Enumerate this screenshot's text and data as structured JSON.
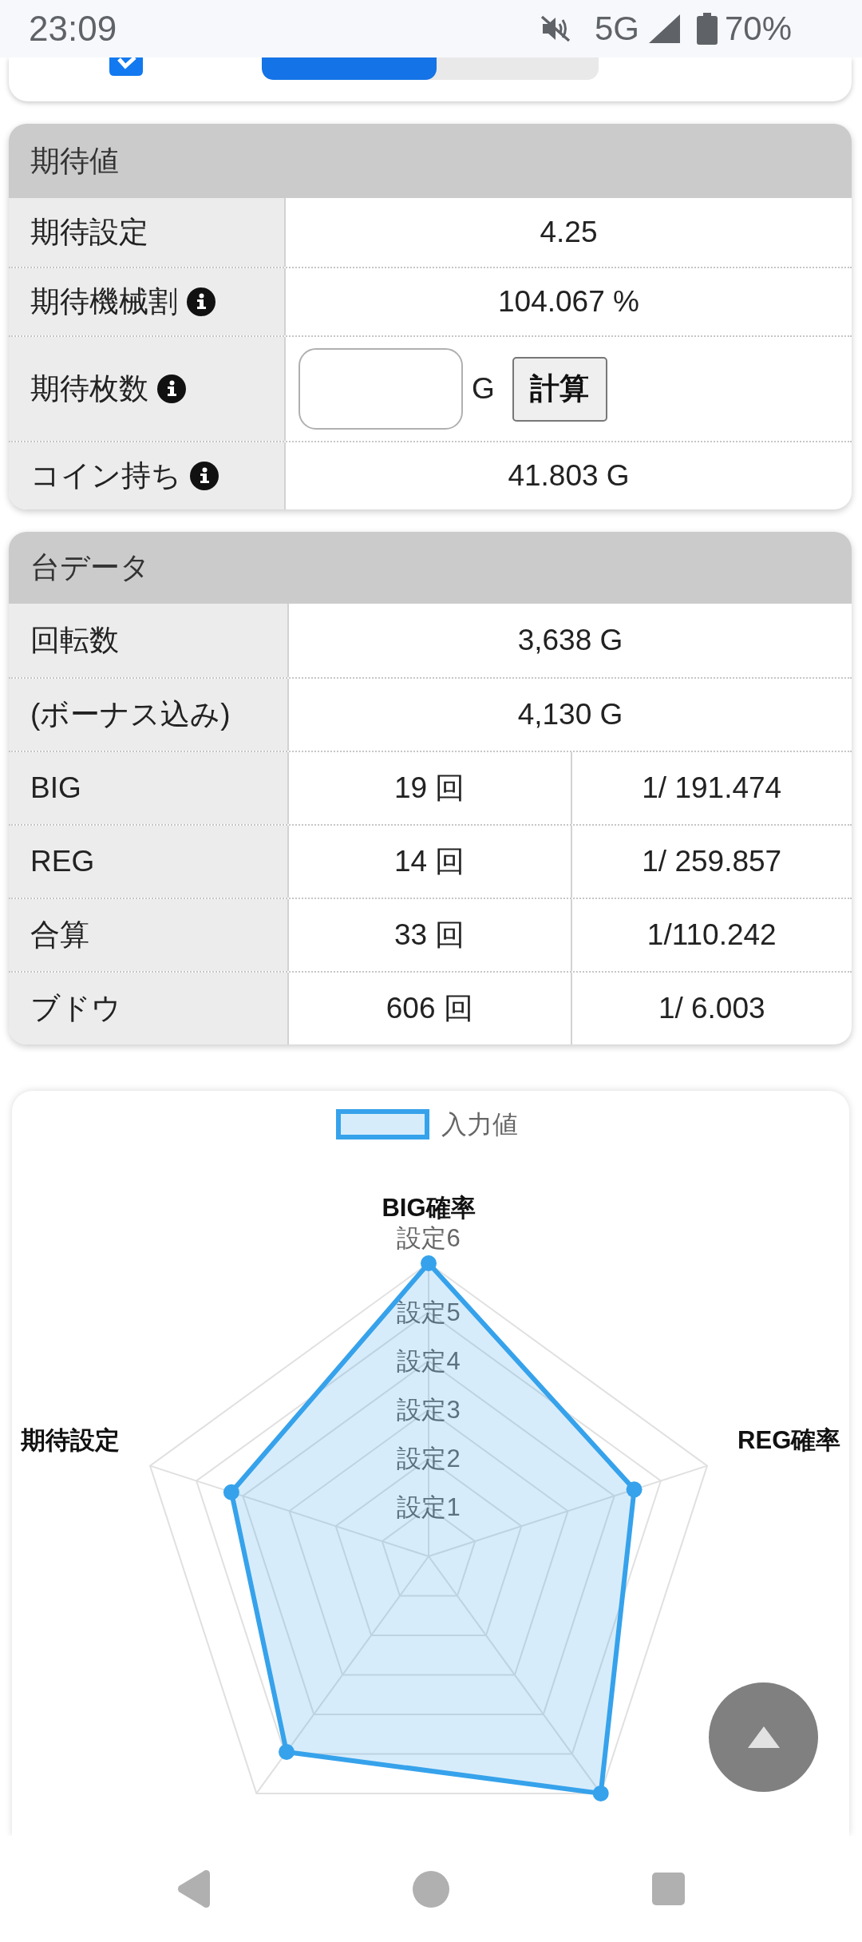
{
  "status_bar": {
    "time": "23:09",
    "network": "5G",
    "battery": "70%"
  },
  "settings_card": {
    "rows": [
      {
        "checked": true,
        "level": 0.52
      }
    ]
  },
  "expected": {
    "title": "期待値",
    "rows": [
      {
        "kind": "value",
        "label": "期待設定",
        "info": false,
        "value": "4.25"
      },
      {
        "kind": "value",
        "label": "期待機械割",
        "info": true,
        "value": "104.067 %"
      },
      {
        "kind": "input",
        "label": "期待枚数",
        "info": true,
        "unit": "G",
        "button": "計算"
      },
      {
        "kind": "value",
        "label": "コイン持ち",
        "info": true,
        "value": "41.803 G"
      }
    ]
  },
  "machine_data": {
    "title": "台データ",
    "rows": [
      {
        "label": "回転数",
        "values": [
          "3,638 G"
        ]
      },
      {
        "label": "(ボーナス込み)",
        "values": [
          "4,130 G"
        ]
      },
      {
        "label": "BIG",
        "values": [
          "19 回",
          "1/ 191.474"
        ]
      },
      {
        "label": "REG",
        "values": [
          "14 回",
          "1/ 259.857"
        ]
      },
      {
        "label": "合算",
        "values": [
          "33 回",
          "1/110.242"
        ]
      },
      {
        "label": "ブドウ",
        "values": [
          "606 回",
          "1/ 6.003"
        ]
      }
    ]
  },
  "radar_chart": {
    "legend": "入力値",
    "axis_labels": [
      "BIG確率",
      "REG確率",
      "期待設定"
    ],
    "scale_labels": [
      "設定6",
      "設定5",
      "設定4",
      "設定3",
      "設定2",
      "設定1"
    ]
  }
}
